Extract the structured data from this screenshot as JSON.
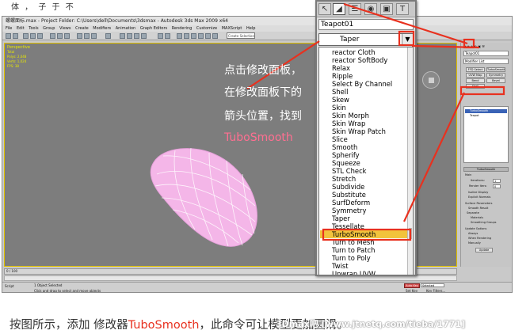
{
  "top_caption": "体 ，       子 于 不",
  "window": {
    "title": "螺螺面标.max  - Project Folder: C:\\Users\\dell\\Documents\\3dsmax  - Autodesk 3ds Max 2009 x64",
    "menus": [
      "File",
      "Edit",
      "Tools",
      "Group",
      "Views",
      "Create",
      "Modifiers",
      "Animation",
      "Graph Editors",
      "Rendering",
      "Customize",
      "MAXScript",
      "Help"
    ],
    "selection_set": "Create Selection Set"
  },
  "viewport": {
    "label": "Perspective",
    "stats": [
      "Total",
      "Polys: 2,048",
      "Verts: 1,024",
      "FPS: 38"
    ],
    "teapot_color": "#f4b6e8"
  },
  "command_panel": {
    "object_name": "Teapot01",
    "modifier_list": "Modifier List",
    "buttons": [
      "FFD Select",
      "TurboSmooth",
      "UVW Map",
      "Symmetry",
      "Bend",
      "Bevel",
      "Shell"
    ],
    "stack_selected": "TurboSmooth",
    "stack_base": "Teapot",
    "rollout_main": "TurboSmooth",
    "main_label": "Main",
    "iterations_label": "Iterations:",
    "iterations_value": "1",
    "render_iters_label": "Render Iters:",
    "render_iters_value": "0",
    "isoline": "Isoline Display",
    "explicit_normals": "Explicit Normals",
    "surface_params": "Surface Parameters",
    "smooth_result": "Smooth Result",
    "separate": "Separate",
    "materials": "Materials",
    "smoothing_groups": "Smoothing Groups",
    "update_options": "Update Options",
    "always": "Always",
    "when_rendering": "When Rendering",
    "manually": "Manually",
    "update_btn": "Update"
  },
  "timeline": {
    "frame": "0 / 100"
  },
  "statusbar": {
    "selected": "1 Object Selected",
    "hint": "Click and drag to select and move objects",
    "script": "Script",
    "auto_key": "Auto Key",
    "selected_field": "Selected",
    "set_key": "Set Key",
    "key_filters": "Key Filters..."
  },
  "zoom": {
    "object_name": "Teapot01",
    "current_modifier": "Taper",
    "items": [
      "reactor Cloth",
      "reactor SoftBody",
      "Relax",
      "Ripple",
      "Select By Channel",
      "Shell",
      "Skew",
      "Skin",
      "Skin Morph",
      "Skin Wrap",
      "Skin Wrap Patch",
      "Slice",
      "Smooth",
      "Spherify",
      "Squeeze",
      "STL Check",
      "Stretch",
      "Subdivide",
      "Substitute",
      "SurfDeform",
      "Symmetry",
      "Taper",
      "Tessellate",
      "TurboSmooth",
      "Turn to Mesh",
      "Turn to Patch",
      "Turn to Poly",
      "Twist",
      "Unwrap UVW"
    ],
    "highlighted": "TurboSmooth"
  },
  "annotations": {
    "line1": "点击修改面板，",
    "line2": "在修改面板下的",
    "line3": "箭头位置，找到",
    "line4": "TuboSmooth",
    "color": "#e8311f"
  },
  "caption": {
    "prefix": "按图所示，添加 修改器",
    "highlight": "TuboSmooth",
    "suffix": "，此命令可让模型更加圆滑。"
  },
  "watermark": "3Dmax吧 [www.jtnetq.com/tieba/1771]"
}
